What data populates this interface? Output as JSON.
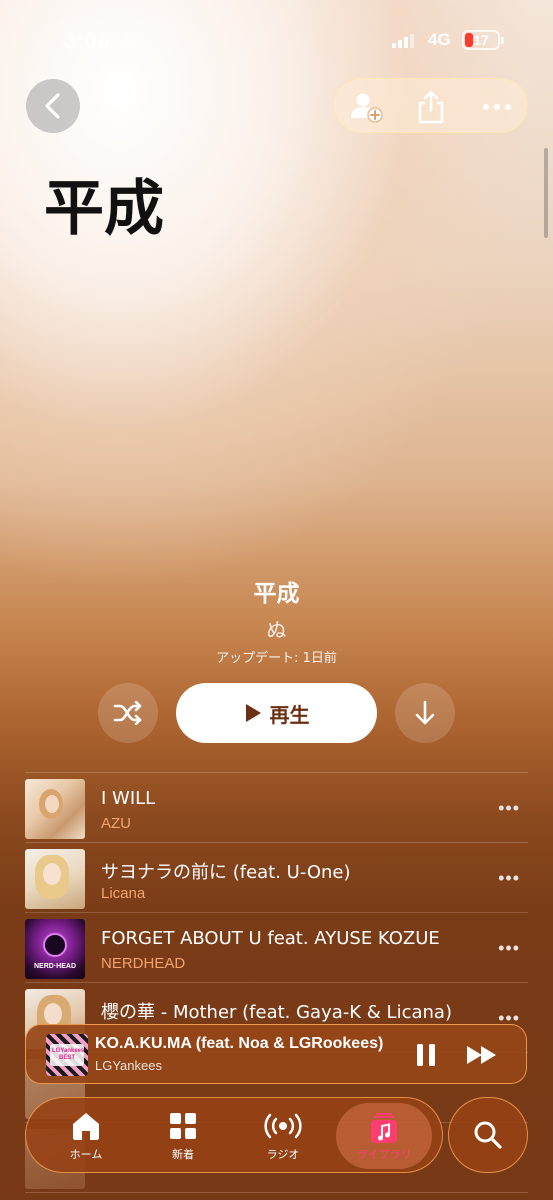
{
  "status_bar": {
    "time": "3:06",
    "network": "4G",
    "battery": "17"
  },
  "header": {
    "title": "平成"
  },
  "playlist": {
    "title": "平成",
    "author": "ぬ",
    "updated": "アップデート: 1日前"
  },
  "actions": {
    "play_label": "再生"
  },
  "tracks": [
    {
      "title": "I WILL",
      "artist": "AZU"
    },
    {
      "title": "サヨナラの前に (feat. U-One)",
      "artist": "Licana"
    },
    {
      "title": "FORGET ABOUT U feat. AYUSE KOZUE",
      "artist": "NERDHEAD"
    },
    {
      "title": "櫻の華 - Mother (feat. Gaya-K & Licana)",
      "artist": ""
    }
  ],
  "now_playing": {
    "title": "KO.A.KU.MA (feat. Noa & LGRookees)",
    "artist": "LGYankees"
  },
  "tabs": [
    {
      "label": "ホーム",
      "icon": "home-icon"
    },
    {
      "label": "新着",
      "icon": "grid-icon"
    },
    {
      "label": "ラジオ",
      "icon": "radio-icon"
    },
    {
      "label": "ライブラリ",
      "icon": "library-icon"
    }
  ],
  "colors": {
    "accent": "#ff3d6e",
    "background": "#7a3a16",
    "play_button_text": "#6b2f12"
  }
}
